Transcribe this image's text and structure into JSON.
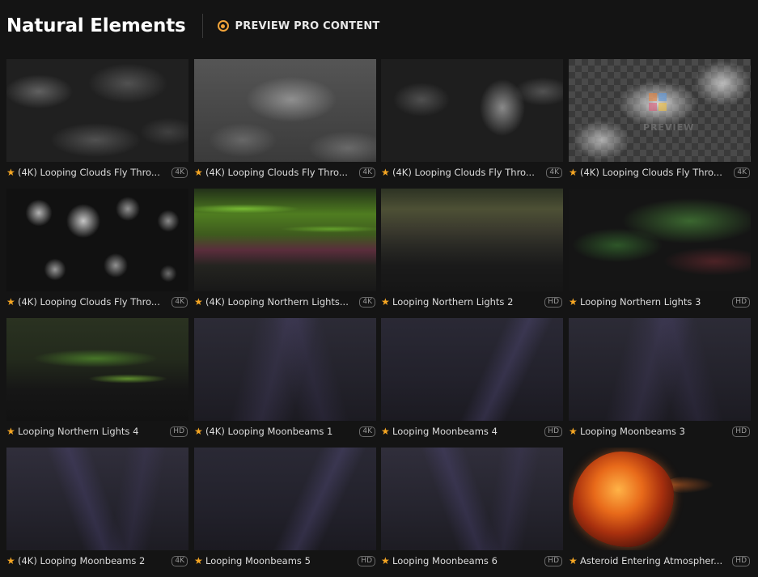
{
  "header": {
    "title": "Natural Elements",
    "preview_label": "PREVIEW PRO CONTENT"
  },
  "colors": {
    "accent": "#f5a623",
    "background": "#141414",
    "text": "#dcdcdc"
  },
  "icons": {
    "star": "★",
    "radio": "radio-selected-icon"
  },
  "items": [
    {
      "title": "(4K) Looping Clouds Fly Thro...",
      "badge": "4K"
    },
    {
      "title": "(4K) Looping Clouds Fly Thro...",
      "badge": "4K"
    },
    {
      "title": "(4K) Looping Clouds Fly Thro...",
      "badge": "4K"
    },
    {
      "title": "(4K) Looping Clouds Fly Thro...",
      "badge": "4K"
    },
    {
      "title": "(4K) Looping Clouds Fly Thro...",
      "badge": "4K"
    },
    {
      "title": "(4K) Looping Northern Lights...",
      "badge": "4K"
    },
    {
      "title": "Looping Northern Lights 2",
      "badge": "HD"
    },
    {
      "title": "Looping Northern Lights 3",
      "badge": "HD"
    },
    {
      "title": "Looping Northern Lights 4",
      "badge": "HD"
    },
    {
      "title": "(4K) Looping Moonbeams 1",
      "badge": "4K"
    },
    {
      "title": "Looping Moonbeams 4",
      "badge": "HD"
    },
    {
      "title": "Looping Moonbeams 3",
      "badge": "HD"
    },
    {
      "title": "(4K) Looping Moonbeams 2",
      "badge": "4K"
    },
    {
      "title": "Looping Moonbeams 5",
      "badge": "HD"
    },
    {
      "title": "Looping Moonbeams 6",
      "badge": "HD"
    },
    {
      "title": "Asteroid Entering Atmospher...",
      "badge": "HD"
    }
  ],
  "watermark": "PREVIEW"
}
